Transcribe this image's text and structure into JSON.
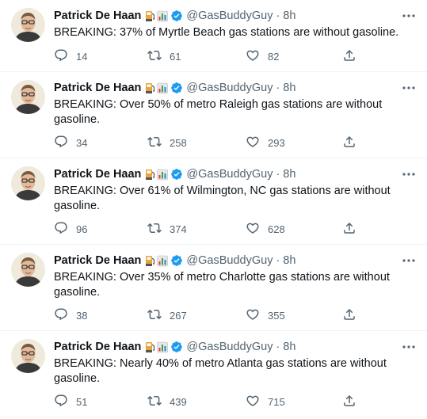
{
  "tweets": [
    {
      "name": "Patrick De Haan",
      "handle": "@GasBuddyGuy",
      "separator": "·",
      "time": "8h",
      "emoji": [
        "fuel-pump",
        "bar-chart"
      ],
      "text": "BREAKING: 37% of Myrtle Beach gas stations are without gasoline.",
      "replies": "14",
      "retweets": "61",
      "likes": "82"
    },
    {
      "name": "Patrick De Haan",
      "handle": "@GasBuddyGuy",
      "separator": "·",
      "time": "8h",
      "emoji": [
        "fuel-pump",
        "bar-chart"
      ],
      "text": "BREAKING: Over 50% of metro Raleigh gas stations are without gasoline.",
      "replies": "34",
      "retweets": "258",
      "likes": "293"
    },
    {
      "name": "Patrick De Haan",
      "handle": "@GasBuddyGuy",
      "separator": "·",
      "time": "8h",
      "emoji": [
        "fuel-pump",
        "bar-chart"
      ],
      "text": "BREAKING: Over 61% of Wilmington, NC gas stations are without gasoline.",
      "replies": "96",
      "retweets": "374",
      "likes": "628"
    },
    {
      "name": "Patrick De Haan",
      "handle": "@GasBuddyGuy",
      "separator": "·",
      "time": "8h",
      "emoji": [
        "fuel-pump",
        "bar-chart"
      ],
      "text": "BREAKING: Over 35% of metro Charlotte gas stations are without gasoline.",
      "replies": "38",
      "retweets": "267",
      "likes": "355"
    },
    {
      "name": "Patrick De Haan",
      "handle": "@GasBuddyGuy",
      "separator": "·",
      "time": "8h",
      "emoji": [
        "fuel-pump",
        "bar-chart"
      ],
      "text": "BREAKING: Nearly 40% of metro Atlanta gas stations are without gasoline.",
      "replies": "51",
      "retweets": "439",
      "likes": "715"
    }
  ],
  "colors": {
    "text": "#0f1419",
    "secondary": "#536471",
    "verified": "#1d9bf0",
    "divider": "#eff3f4"
  },
  "icons": {
    "reply": "reply-icon",
    "retweet": "retweet-icon",
    "like": "like-icon",
    "share": "share-icon",
    "more": "more-icon",
    "verified": "verified-badge-icon"
  }
}
